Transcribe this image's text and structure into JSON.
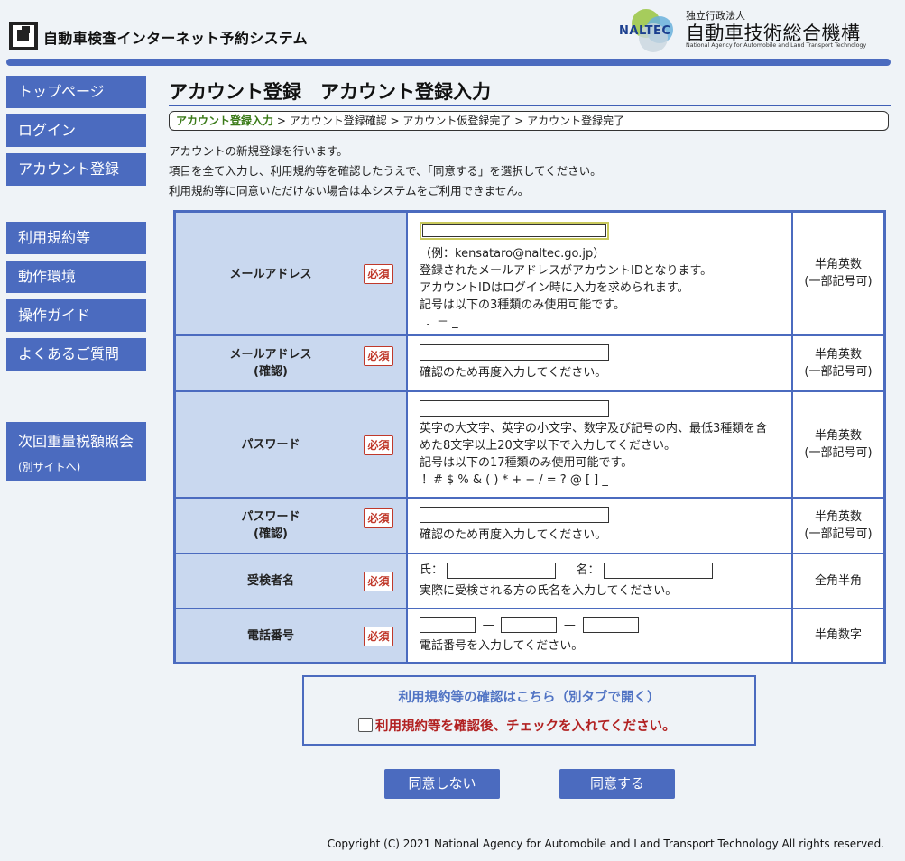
{
  "header": {
    "site_title": "自動車検査インターネット予約システム",
    "org_abbr": "NALTEC",
    "org_type": "独立行政法人",
    "org_name": "自動車技術総合機構",
    "org_name_en": "National Agency for Automobile and Land Transport Technology"
  },
  "sidebar": {
    "items": [
      {
        "label": "トップページ"
      },
      {
        "label": "ログイン"
      },
      {
        "label": "アカウント登録"
      },
      {
        "label": "利用規約等"
      },
      {
        "label": "動作環境"
      },
      {
        "label": "操作ガイド"
      },
      {
        "label": "よくあるご質問"
      }
    ],
    "external": {
      "label": "次回重量税額照会",
      "sub": "(別サイトへ)"
    }
  },
  "main": {
    "title": "アカウント登録　アカウント登録入力",
    "breadcrumb": {
      "steps": [
        "アカウント登録入力",
        "アカウント登録確認",
        "アカウント仮登録完了",
        "アカウント登録完了"
      ],
      "separator": " > "
    },
    "intro": [
      "アカウントの新規登録を行います。",
      "項目を全て入力し、利用規約等を確認したうえで、「同意する」を選択してください。",
      "利用規約等に同意いただけない場合は本システムをご利用できません。"
    ]
  },
  "form": {
    "required_label": "必須",
    "email": {
      "label": "メールアドレス",
      "value": "",
      "notes": [
        "（例：kensataro@naltec.go.jp）",
        "登録されたメールアドレスがアカウントIDとなります。",
        "アカウントIDはログイン時に入力を求められます。",
        "記号は以下の3種類のみ使用可能です。",
        "．－ _"
      ],
      "type": "半角英数\n(一部記号可)"
    },
    "email_confirm": {
      "label": "メールアドレス\n(確認)",
      "value": "",
      "note": "確認のため再度入力してください。",
      "type": "半角英数\n(一部記号可)"
    },
    "password": {
      "label": "パスワード",
      "value": "",
      "notes": [
        "英字の大文字、英字の小文字、数字及び記号の内、最低3種類を含",
        "めた8文字以上20文字以下で入力してください。",
        "記号は以下の17種類のみ使用可能です。",
        "！# $ % & ( ) * + − / = ? @ [ ] _"
      ],
      "type": "半角英数\n(一部記号可)"
    },
    "password_confirm": {
      "label": "パスワード\n(確認)",
      "value": "",
      "note": "確認のため再度入力してください。",
      "type": "半角英数\n(一部記号可)"
    },
    "examinee_name": {
      "label": "受検者名",
      "last_label": "氏：",
      "first_label": "名：",
      "last_value": "",
      "first_value": "",
      "note": "実際に受検される方の氏名を入力してください。",
      "type": "全角半角"
    },
    "phone": {
      "label": "電話番号",
      "separator": "—",
      "values": [
        "",
        "",
        ""
      ],
      "note": "電話番号を入力してください。",
      "type": "半角数字"
    }
  },
  "terms": {
    "link": "利用規約等の確認はこちら（別タブで開く）",
    "check_label": "利用規約等を確認後、チェックを入れてください。",
    "checked": false
  },
  "buttons": {
    "disagree": "同意しない",
    "agree": "同意する"
  },
  "footer": {
    "copyright": "Copyright (C) 2021 National Agency for Automobile and Land Transport Technology All rights reserved."
  }
}
